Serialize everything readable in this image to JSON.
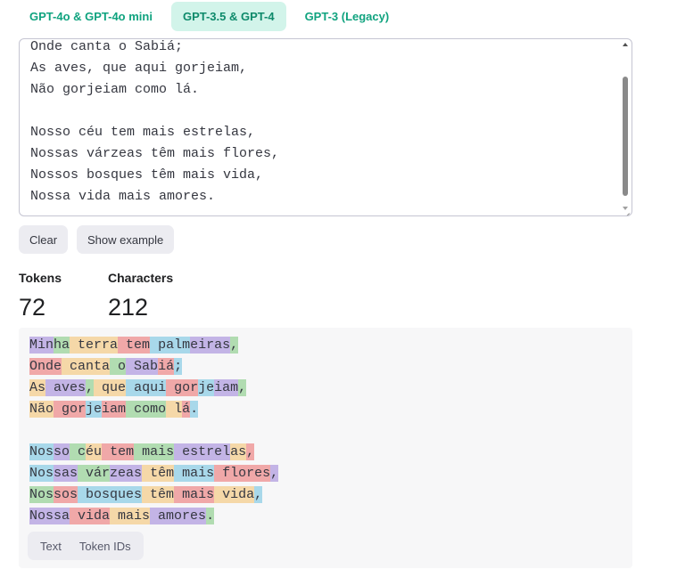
{
  "tabs": [
    {
      "label": "GPT-4o & GPT-4o mini",
      "active": false
    },
    {
      "label": "GPT-3.5 & GPT-4",
      "active": true
    },
    {
      "label": "GPT-3 (Legacy)",
      "active": false
    }
  ],
  "editor": {
    "lines": [
      "Onde canta o Sabiá;",
      "As aves, que aqui gorjeiam,",
      "Não gorjeiam como lá.",
      "",
      "Nosso céu tem mais estrelas,",
      "Nossas várzeas têm mais flores,",
      "Nossos bosques têm mais vida,",
      "Nossa vida mais amores."
    ]
  },
  "buttons": {
    "clear": "Clear",
    "show_example": "Show example"
  },
  "stats": {
    "tokens_label": "Tokens",
    "tokens_value": "72",
    "characters_label": "Characters",
    "characters_value": "212"
  },
  "token_colors": [
    "#c3b4e6",
    "#b1dcb1",
    "#f5d8a8",
    "#f0a8a8",
    "#a8d8ea"
  ],
  "tokenized_output": [
    [
      {
        "t": "Min",
        "c": 0
      },
      {
        "t": "ha",
        "c": 1
      },
      {
        "t": " terra",
        "c": 2
      },
      {
        "t": " tem",
        "c": 3
      },
      {
        "t": " palm",
        "c": 4
      },
      {
        "t": "eiras",
        "c": 0
      },
      {
        "t": ",",
        "c": 1
      }
    ],
    [
      {
        "t": "Onde",
        "c": 3
      },
      {
        "t": " canta",
        "c": 2
      },
      {
        "t": " o",
        "c": 1
      },
      {
        "t": " Sab",
        "c": 0
      },
      {
        "t": "iá",
        "c": 3
      },
      {
        "t": ";",
        "c": 4
      }
    ],
    [
      {
        "t": "As",
        "c": 2
      },
      {
        "t": " aves",
        "c": 0
      },
      {
        "t": ",",
        "c": 1
      },
      {
        "t": " que",
        "c": 2
      },
      {
        "t": " aqui",
        "c": 4
      },
      {
        "t": " gor",
        "c": 3
      },
      {
        "t": "je",
        "c": 4
      },
      {
        "t": "iam",
        "c": 0
      },
      {
        "t": ",",
        "c": 1
      }
    ],
    [
      {
        "t": "Não",
        "c": 2
      },
      {
        "t": " gor",
        "c": 3
      },
      {
        "t": "je",
        "c": 4
      },
      {
        "t": "iam",
        "c": 3
      },
      {
        "t": " como",
        "c": 1
      },
      {
        "t": " l",
        "c": 2
      },
      {
        "t": "á",
        "c": 3
      },
      {
        "t": ".",
        "c": 4
      }
    ],
    [],
    [
      {
        "t": "Nos",
        "c": 4
      },
      {
        "t": "so",
        "c": 0
      },
      {
        "t": " c",
        "c": 1
      },
      {
        "t": "éu",
        "c": 2
      },
      {
        "t": " tem",
        "c": 3
      },
      {
        "t": " mais",
        "c": 1
      },
      {
        "t": " estrel",
        "c": 0
      },
      {
        "t": "as",
        "c": 2
      },
      {
        "t": ",",
        "c": 3
      }
    ],
    [
      {
        "t": "Nos",
        "c": 4
      },
      {
        "t": "sas",
        "c": 0
      },
      {
        "t": " vár",
        "c": 1
      },
      {
        "t": "zeas",
        "c": 0
      },
      {
        "t": " têm",
        "c": 2
      },
      {
        "t": " mais",
        "c": 4
      },
      {
        "t": " flores",
        "c": 3
      },
      {
        "t": ",",
        "c": 0
      }
    ],
    [
      {
        "t": "Nos",
        "c": 1
      },
      {
        "t": "sos",
        "c": 3
      },
      {
        "t": " bosques",
        "c": 4
      },
      {
        "t": " têm",
        "c": 2
      },
      {
        "t": " mais",
        "c": 3
      },
      {
        "t": " vida",
        "c": 2
      },
      {
        "t": ",",
        "c": 4
      }
    ],
    [
      {
        "t": "Nossa",
        "c": 0
      },
      {
        "t": " vida",
        "c": 3
      },
      {
        "t": " mais",
        "c": 2
      },
      {
        "t": " amores",
        "c": 0
      },
      {
        "t": ".",
        "c": 1
      }
    ]
  ],
  "view_toggle": {
    "text": "Text",
    "token_ids": "Token IDs"
  }
}
